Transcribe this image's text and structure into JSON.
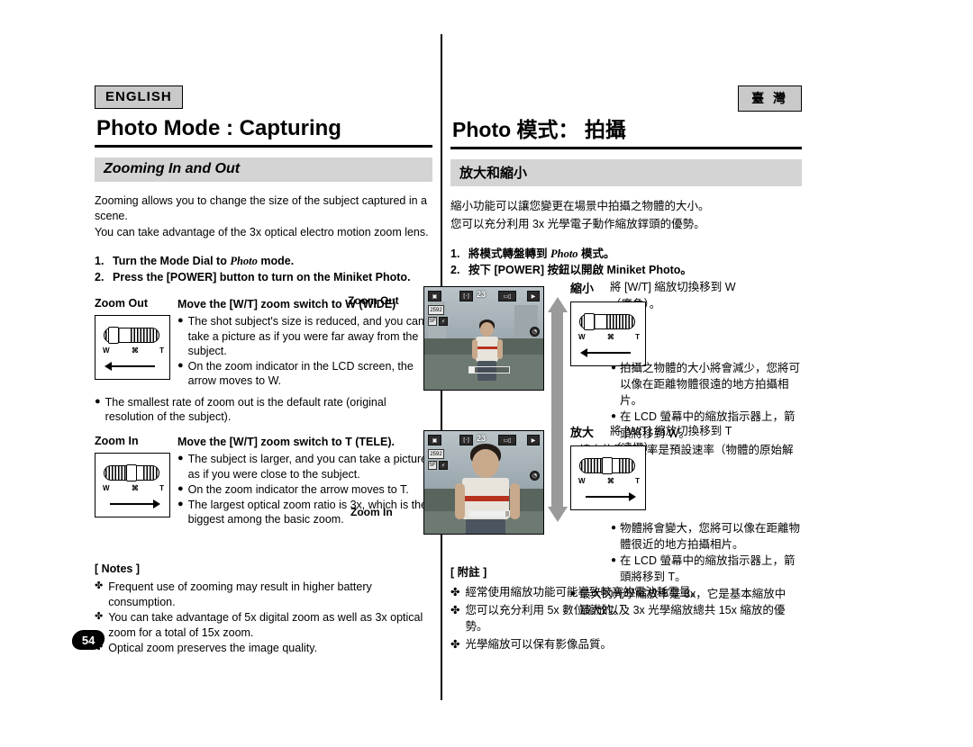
{
  "left": {
    "language_badge": "ENGLISH",
    "page_title": "Photo Mode : Capturing",
    "section_title": "Zooming In and Out",
    "intro": [
      "Zooming allows you to change the size of the subject captured in a scene.",
      "You can take advantage of the 3x optical electro motion zoom lens."
    ],
    "steps": [
      {
        "num": "1.",
        "pre": "Turn the Mode Dial to ",
        "italic": "Photo",
        "post": " mode."
      },
      {
        "num": "2.",
        "pre": "Press the [POWER] button to turn on the Miniket Photo.",
        "italic": "",
        "post": ""
      }
    ],
    "zoom_out": {
      "label": "Zoom Out",
      "heading": "Move the [W/T] zoom switch to W (WIDE)",
      "bullets": [
        "The shot subject's size is reduced, and you can take a picture as if you were far away from the subject.",
        "On the zoom indicator in the LCD screen, the arrow moves to W."
      ],
      "outer_bullets": [
        "The smallest rate of zoom out is the default rate (original resolution of the subject)."
      ]
    },
    "zoom_in": {
      "label": "Zoom In",
      "heading": "Move the [W/T] zoom switch to T (TELE).",
      "bullets": [
        "The subject is larger, and you can take a picture as if you were close to the subject.",
        "On the zoom indicator the arrow moves to T.",
        "The largest optical zoom ratio is 3x, which is the biggest among the basic zoom."
      ],
      "outer_bullets": []
    },
    "notes_title": "[ Notes ]",
    "notes": [
      "Frequent use of zooming may result in higher battery consumption.",
      "You can take advantage of 5x digital zoom as well as 3x optical zoom for a total of 15x zoom.",
      "Optical zoom preserves the image quality."
    ],
    "page_number": "54",
    "lcd_labels": {
      "w": "W",
      "mid": "⌘",
      "t": "T"
    }
  },
  "right": {
    "language_badge": "臺 灣",
    "page_title": "Photo 模式： 拍攝",
    "section_title": "放大和縮小",
    "intro": [
      "縮小功能可以讓您變更在場景中拍攝之物體的大小。",
      "您可以充分利用 3x 光學電子動作縮放鐣頭的優勢。"
    ],
    "steps": [
      {
        "num": "1.",
        "pre": "將模式轉盤轉到 ",
        "italic": "Photo",
        "post": " 模式。"
      },
      {
        "num": "2.",
        "pre": "按下 [POWER] 按鈕以開啟 Miniket Photo。",
        "italic": "",
        "post": ""
      }
    ],
    "zoom_out": {
      "label": "縮小",
      "heading": "將 [W/T] 縮放切換移到 W（廣角）。",
      "bullets": [
        "拍攝之物體的大小將會減少，您將可以像在距離物體很遠的地方拍攝相片。",
        "在 LCD 螢幕中的縮放指示器上，箭頭將移到 W。"
      ],
      "outer_bullets": [
        "縮小的最小速率是預設速率（物體的原始解析度）。"
      ]
    },
    "zoom_in": {
      "label": "放大",
      "heading": "將 [W/T] 縮放切換移到 T（遠攝）。",
      "bullets": [
        "物體將會變大，您將可以像在距離物體很近的地方拍攝相片。",
        "在 LCD 螢幕中的縮放指示器上，箭頭將移到 T。"
      ],
      "outer_bullets": [
        "最大的光學縮放率是 3x，它是基本縮放中最大的。"
      ]
    },
    "notes_title": "[ 附註 ]",
    "notes": [
      "經常使用縮放功能可能導致較高的電池耗電量。",
      "您可以充分利用 5x 數位縮放以及 3x 光學縮放總共 15x 縮放的優勢。",
      "光學縮放可以保有影像品質。"
    ]
  },
  "figures": {
    "zoom_out_caption": "Zoom Out",
    "zoom_in_caption": "Zoom In",
    "osd": {
      "counter": "23",
      "mode_icon": "camera-icon",
      "resolution": "2592",
      "quality": "SF",
      "battery": "battery-icon",
      "play": "play-icon",
      "flash": "flash-icon",
      "timer": "timer-icon"
    }
  },
  "colors": {
    "bar_gray": "#d4d4d4",
    "badge_gray": "#c9c9c9",
    "arrow_gray": "#9a9a9a",
    "ink": "#000000"
  }
}
